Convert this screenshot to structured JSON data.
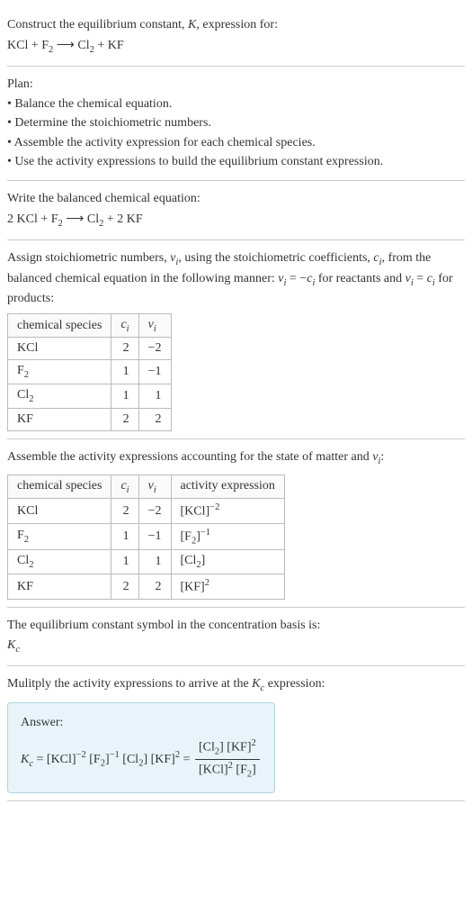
{
  "intro": {
    "title": "Construct the equilibrium constant, K, expression for:",
    "equation": "KCl + F₂ ⟶ Cl₂ + KF"
  },
  "plan": {
    "heading": "Plan:",
    "items": [
      "• Balance the chemical equation.",
      "• Determine the stoichiometric numbers.",
      "• Assemble the activity expression for each chemical species.",
      "• Use the activity expressions to build the equilibrium constant expression."
    ]
  },
  "balanced": {
    "heading": "Write the balanced chemical equation:",
    "equation": "2 KCl + F₂ ⟶ Cl₂ + 2 KF"
  },
  "stoich": {
    "heading": "Assign stoichiometric numbers, νᵢ, using the stoichiometric coefficients, cᵢ, from the balanced chemical equation in the following manner: νᵢ = −cᵢ for reactants and νᵢ = cᵢ for products:",
    "cols": [
      "chemical species",
      "cᵢ",
      "νᵢ"
    ],
    "rows": [
      {
        "species": "KCl",
        "c": "2",
        "v": "−2"
      },
      {
        "species": "F₂",
        "c": "1",
        "v": "−1"
      },
      {
        "species": "Cl₂",
        "c": "1",
        "v": "1"
      },
      {
        "species": "KF",
        "c": "2",
        "v": "2"
      }
    ]
  },
  "activity": {
    "heading": "Assemble the activity expressions accounting for the state of matter and νᵢ:",
    "cols": [
      "chemical species",
      "cᵢ",
      "νᵢ",
      "activity expression"
    ],
    "rows": [
      {
        "species": "KCl",
        "c": "2",
        "v": "−2",
        "expr": "[KCl]⁻²"
      },
      {
        "species": "F₂",
        "c": "1",
        "v": "−1",
        "expr": "[F₂]⁻¹"
      },
      {
        "species": "Cl₂",
        "c": "1",
        "v": "1",
        "expr": "[Cl₂]"
      },
      {
        "species": "KF",
        "c": "2",
        "v": "2",
        "expr": "[KF]²"
      }
    ]
  },
  "symbol": {
    "heading": "The equilibrium constant symbol in the concentration basis is:",
    "value": "K𝒸"
  },
  "multiply": {
    "heading": "Mulitply the activity expressions to arrive at the K𝒸 expression:"
  },
  "answer": {
    "label": "Answer:",
    "left": "K𝒸 = [KCl]⁻² [F₂]⁻¹ [Cl₂] [KF]² =",
    "frac_num": "[Cl₂] [KF]²",
    "frac_den": "[KCl]² [F₂]"
  }
}
